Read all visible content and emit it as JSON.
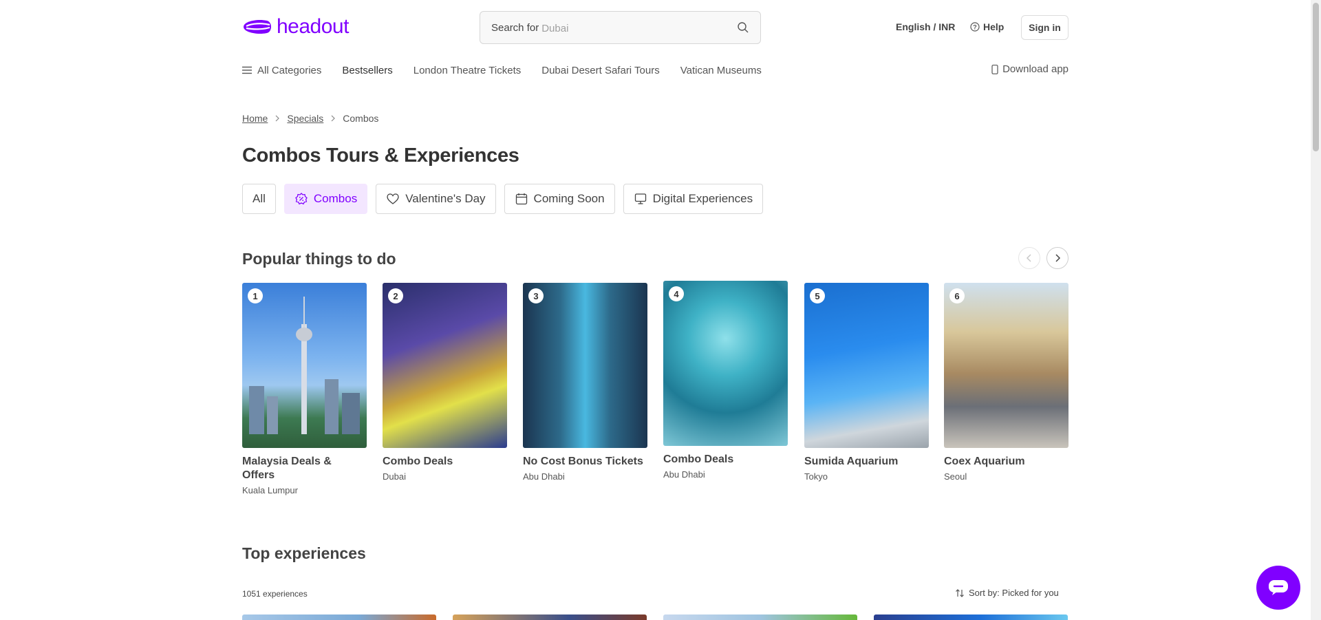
{
  "header": {
    "logo_text": "headout",
    "search": {
      "label": "Search for",
      "placeholder": "Dubai"
    },
    "language_currency": "English / INR",
    "help_label": "Help",
    "signin_label": "Sign in",
    "brand_color": "#8000ff"
  },
  "category_nav": {
    "all_categories": "All Categories",
    "items": [
      "Bestsellers",
      "London Theatre Tickets",
      "Dubai Desert Safari Tours",
      "Vatican Museums"
    ],
    "download_app": "Download app"
  },
  "breadcrumb": {
    "home": "Home",
    "specials": "Specials",
    "current": "Combos"
  },
  "page_title": "Combos Tours & Experiences",
  "chips": [
    {
      "label": "All",
      "icon": "none",
      "active": false
    },
    {
      "label": "Combos",
      "icon": "badge-icon",
      "active": true
    },
    {
      "label": "Valentine's Day",
      "icon": "heart-icon",
      "active": false
    },
    {
      "label": "Coming Soon",
      "icon": "calendar-icon",
      "active": false
    },
    {
      "label": "Digital Experiences",
      "icon": "monitor-icon",
      "active": false
    }
  ],
  "popular": {
    "title": "Popular things to do",
    "cards": [
      {
        "rank": "1",
        "title": "Malaysia Deals & Offers",
        "city": "Kuala Lumpur"
      },
      {
        "rank": "2",
        "title": "Combo Deals",
        "city": "Dubai"
      },
      {
        "rank": "3",
        "title": "No Cost Bonus Tickets",
        "city": "Abu Dhabi"
      },
      {
        "rank": "4",
        "title": "Combo Deals",
        "city": "Abu Dhabi"
      },
      {
        "rank": "5",
        "title": "Sumida Aquarium",
        "city": "Tokyo"
      },
      {
        "rank": "6",
        "title": "Coex Aquarium",
        "city": "Seoul"
      }
    ]
  },
  "top": {
    "title": "Top experiences",
    "count": "1051 experiences",
    "sort_label": "Sort by: Picked for you"
  }
}
